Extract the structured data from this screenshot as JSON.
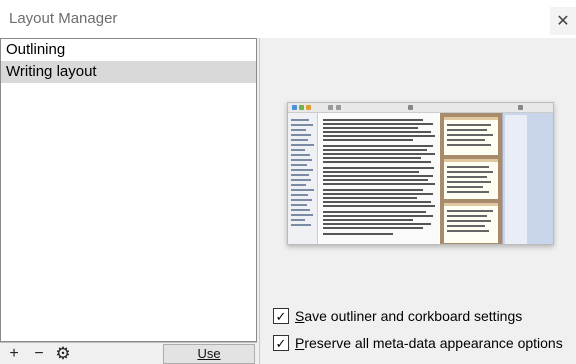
{
  "window": {
    "title": "Layout Manager",
    "close_glyph": "✕"
  },
  "layouts": [
    {
      "label": "Outlining",
      "selected": false
    },
    {
      "label": "Writing layout",
      "selected": true
    }
  ],
  "toolbar": {
    "add_icon": "+",
    "remove_icon": "−",
    "settings_icon": "⚙",
    "use_label": "Use"
  },
  "options": {
    "save_outliner": {
      "label_first": "S",
      "label_rest": "ave outliner and corkboard settings",
      "checked": true
    },
    "preserve_meta": {
      "label_first": "P",
      "label_rest": "reserve all meta-data appearance options",
      "checked": true
    }
  },
  "colors": {
    "selected_row": "#d9d9d9",
    "corkboard": "#a88b6b",
    "inspector": "#c9d5ea"
  }
}
